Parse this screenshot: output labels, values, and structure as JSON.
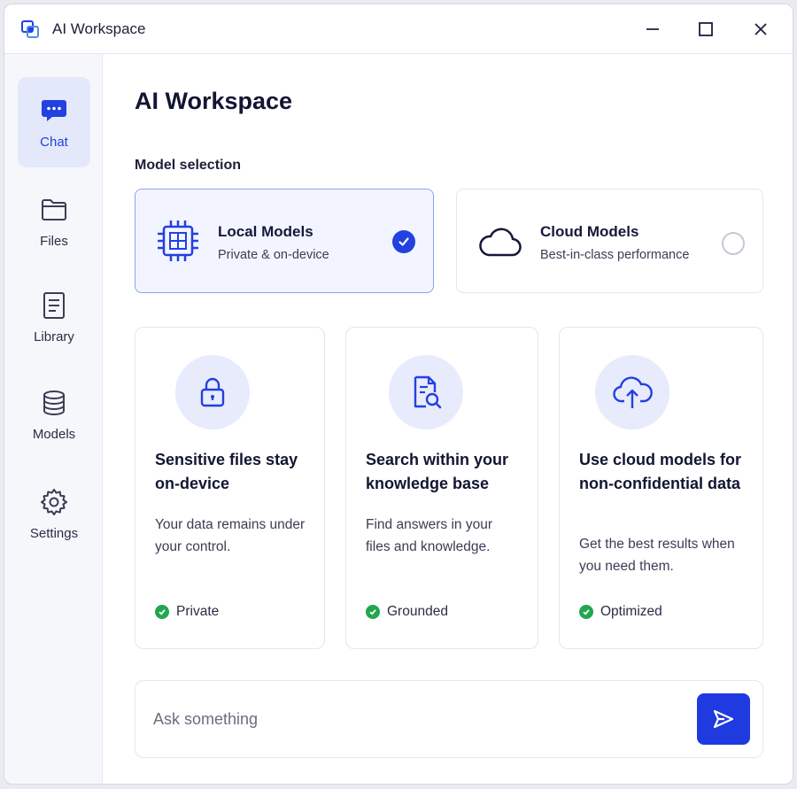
{
  "window": {
    "title": "AI Workspace"
  },
  "sidebar": {
    "items": [
      {
        "label": "Chat",
        "icon": "chat-bubble-icon",
        "active": true
      },
      {
        "label": "Files",
        "icon": "folder-icon",
        "active": false
      },
      {
        "label": "Library",
        "icon": "document-icon",
        "active": false
      },
      {
        "label": "Models",
        "icon": "database-icon",
        "active": false
      },
      {
        "label": "Settings",
        "icon": "gear-icon",
        "active": false
      }
    ]
  },
  "main": {
    "title": "AI Workspace",
    "section_label": "Model selection",
    "models": [
      {
        "name": "Local Models",
        "description": "Private & on-device",
        "icon": "chip-icon",
        "selected": true
      },
      {
        "name": "Cloud Models",
        "description": "Best-in-class performance",
        "icon": "cloud-icon",
        "selected": false
      }
    ],
    "features": [
      {
        "title": "Sensitive files stay on-device",
        "description": "Your data remains under your control.",
        "badge": "Private",
        "icon": "lock-icon"
      },
      {
        "title": "Search within your knowledge base",
        "description": "Find answers in your files and knowledge.",
        "badge": "Grounded",
        "icon": "document-search-icon"
      },
      {
        "title": "Use cloud models for non-confidential data",
        "description": "Get the best results when you need them.",
        "badge": "Optimized",
        "icon": "cloud-upload-icon"
      }
    ],
    "ask": {
      "placeholder": "Ask something",
      "value": ""
    }
  },
  "colors": {
    "accent": "#2340e0",
    "success": "#22a650",
    "active_nav_bg": "#e4e8fb"
  }
}
